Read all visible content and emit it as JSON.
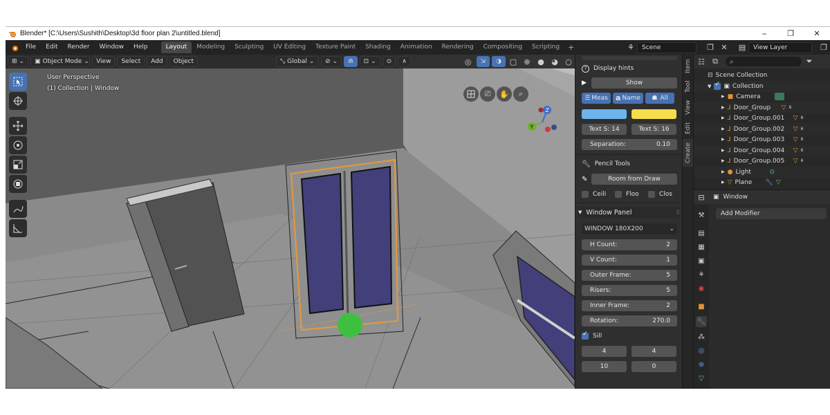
{
  "window": {
    "title": "Blender* [C:\\Users\\Sushith\\Desktop\\3d floor plan 2\\untitled.blend]",
    "minimize": "–",
    "maximize": "❐",
    "close": "✕"
  },
  "menubar": {
    "menus": [
      "File",
      "Edit",
      "Render",
      "Window",
      "Help"
    ],
    "workspaces": [
      "Layout",
      "Modeling",
      "Sculpting",
      "UV Editing",
      "Texture Paint",
      "Shading",
      "Animation",
      "Rendering",
      "Compositing",
      "Scripting"
    ],
    "active_workspace": "Layout",
    "add_workspace": "+",
    "scene": "Scene",
    "view_layer": "View Layer"
  },
  "viewport": {
    "header": {
      "mode": "Object Mode",
      "menus": [
        "View",
        "Select",
        "Add",
        "Object"
      ],
      "transform_orientation": "Global"
    },
    "overlay": {
      "perspective": "User Perspective",
      "collection": "(1) Collection | Window"
    },
    "gizmo": {
      "z": "Z",
      "y": "Y"
    }
  },
  "npanel": {
    "tabs": [
      "Item",
      "Tool",
      "View",
      "Edit",
      "Create"
    ],
    "display_hints": "Display hints",
    "show_button": "Show",
    "meas": "Meas",
    "name": "Name",
    "all": "All",
    "color_blue": "#6db4ec",
    "color_yellow": "#f5de4a",
    "text_s_left": "Text S: 14",
    "text_s_right": "Text S: 16",
    "separation_label": "Separation:",
    "separation_value": "0.10",
    "pencil_tools": "Pencil Tools",
    "room_from_draw": "Room from Draw",
    "ceiling": "Ceili",
    "floor": "Floo",
    "closed": "Clos",
    "window_panel": "Window Panel",
    "window_type": "WINDOW 180X200",
    "fields": [
      {
        "label": "H Count:",
        "value": "2"
      },
      {
        "label": "V Count:",
        "value": "1"
      },
      {
        "label": "Outer Frame:",
        "value": "5"
      },
      {
        "label": "Risers:",
        "value": "5"
      },
      {
        "label": "Inner Frame:",
        "value": "2"
      },
      {
        "label": "Rotation:",
        "value": "270.0"
      }
    ],
    "sill": "Sill",
    "bottom_row1": [
      "4",
      "4"
    ],
    "bottom_row2": [
      "10",
      "0"
    ]
  },
  "outliner": {
    "root": "Scene Collection",
    "collection": "Collection",
    "items": [
      "Camera",
      "Door_Group",
      "Door_Group.001",
      "Door_Group.002",
      "Door_Group.003",
      "Door_Group.004",
      "Door_Group.005",
      "Light",
      "Plane"
    ],
    "badge": "6"
  },
  "properties": {
    "object": "Window",
    "add_modifier": "Add Modifier"
  }
}
